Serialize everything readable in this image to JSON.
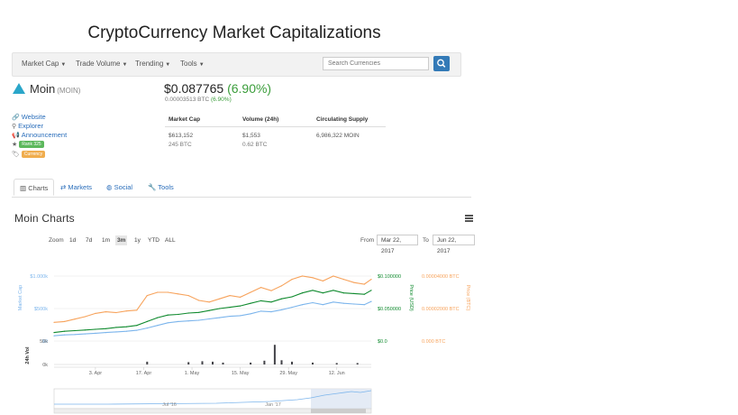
{
  "site": {
    "title": "CryptoCurrency Market Capitalizations"
  },
  "nav": {
    "items": [
      {
        "label": "Market Cap"
      },
      {
        "label": "Trade Volume"
      },
      {
        "label": "Trending"
      },
      {
        "label": "Tools"
      }
    ],
    "search_placeholder": "Search Currencies",
    "search_icon": "search-icon"
  },
  "coin": {
    "name": "Moin",
    "symbol": "(MOIN)",
    "price_usd": "$0.087765",
    "change_usd": "(6.90%)",
    "price_btc": "0.00003513 BTC",
    "change_btc": "(6.90%)",
    "links": [
      {
        "label": "Website",
        "icon": "link-icon"
      },
      {
        "label": "Explorer",
        "icon": "search-icon"
      },
      {
        "label": "Announcement",
        "icon": "bullhorn-icon"
      }
    ],
    "rank_badge": "Rank 325",
    "tag_badge": "Currency",
    "colors": {
      "rank_badge": "#5cb85c",
      "tag_badge": "#f0ad4e",
      "positive": "#3a9d3a",
      "link": "#2a6ebb"
    }
  },
  "stats": {
    "headers": [
      "Market Cap",
      "Volume (24h)",
      "Circulating Supply"
    ],
    "market_cap_usd": "$613,152",
    "market_cap_btc": "245 BTC",
    "volume_usd": "$1,553",
    "volume_btc": "0.62 BTC",
    "supply": "6,986,322 MOIN"
  },
  "tabs": [
    {
      "label": "Charts",
      "icon": "bar-chart-icon",
      "active": true
    },
    {
      "label": "Markets",
      "icon": "exchange-icon",
      "active": false
    },
    {
      "label": "Social",
      "icon": "globe-icon",
      "active": false
    },
    {
      "label": "Tools",
      "icon": "wrench-icon",
      "active": false
    }
  ],
  "chart_section": {
    "title": "Moin Charts",
    "zoom_label": "Zoom",
    "zoom_options": [
      "1d",
      "7d",
      "1m",
      "3m",
      "1y",
      "YTD",
      "ALL"
    ],
    "zoom_selected": "3m",
    "from_label": "From",
    "from_value": "Mar 22, 2017",
    "to_label": "To",
    "to_value": "Jun 22, 2017"
  },
  "chart_data": {
    "type": "line",
    "x_type": "date",
    "x_range": [
      "2017-03-22",
      "2017-06-22"
    ],
    "x_ticks": [
      "3. Apr",
      "17. Apr",
      "1. May",
      "15. May",
      "29. May",
      "12. Jun"
    ],
    "axes": {
      "market_cap": {
        "label": "Market Cap",
        "ticks": [
          "$0",
          "$500k",
          "$1.000k"
        ],
        "ylim": [
          0,
          1000000
        ]
      },
      "price_usd": {
        "label": "Price (USD)",
        "ticks": [
          "$0.0",
          "$0.050000",
          "$0.100000"
        ],
        "ylim": [
          0,
          0.1
        ]
      },
      "price_btc": {
        "label": "Price (BTC)",
        "ticks": [
          "0.000 BTC",
          "0.00002000 BTC",
          "0.00004000 BTC"
        ],
        "ylim": [
          0,
          4e-05
        ]
      },
      "volume": {
        "label": "24h Vol",
        "ticks": [
          "0k",
          "50k"
        ]
      }
    },
    "series": [
      {
        "name": "Market Cap",
        "color": "#7cb5ec",
        "axis": "market_cap",
        "x": [
          "2017-03-22",
          "2017-03-25",
          "2017-03-28",
          "2017-03-31",
          "2017-04-03",
          "2017-04-06",
          "2017-04-09",
          "2017-04-12",
          "2017-04-15",
          "2017-04-18",
          "2017-04-21",
          "2017-04-24",
          "2017-04-27",
          "2017-04-30",
          "2017-05-03",
          "2017-05-06",
          "2017-05-09",
          "2017-05-12",
          "2017-05-15",
          "2017-05-18",
          "2017-05-21",
          "2017-05-24",
          "2017-05-27",
          "2017-05-30",
          "2017-06-02",
          "2017-06-05",
          "2017-06-08",
          "2017-06-11",
          "2017-06-14",
          "2017-06-17",
          "2017-06-20",
          "2017-06-22"
        ],
        "values": [
          80000,
          95000,
          100000,
          110000,
          120000,
          130000,
          140000,
          150000,
          165000,
          200000,
          240000,
          280000,
          300000,
          310000,
          320000,
          340000,
          360000,
          380000,
          390000,
          420000,
          460000,
          450000,
          480000,
          520000,
          560000,
          590000,
          560000,
          600000,
          580000,
          570000,
          560000,
          610000
        ]
      },
      {
        "name": "Price (USD)",
        "color": "#0f8a2e",
        "axis": "price_usd",
        "x": [
          "2017-03-22",
          "2017-03-25",
          "2017-03-28",
          "2017-03-31",
          "2017-04-03",
          "2017-04-06",
          "2017-04-09",
          "2017-04-12",
          "2017-04-15",
          "2017-04-18",
          "2017-04-21",
          "2017-04-24",
          "2017-04-27",
          "2017-04-30",
          "2017-05-03",
          "2017-05-06",
          "2017-05-09",
          "2017-05-12",
          "2017-05-15",
          "2017-05-18",
          "2017-05-21",
          "2017-05-24",
          "2017-05-27",
          "2017-05-30",
          "2017-06-02",
          "2017-06-05",
          "2017-06-08",
          "2017-06-11",
          "2017-06-14",
          "2017-06-17",
          "2017-06-20",
          "2017-06-22"
        ],
        "values": [
          0.013,
          0.015,
          0.016,
          0.017,
          0.018,
          0.019,
          0.021,
          0.022,
          0.024,
          0.03,
          0.036,
          0.04,
          0.041,
          0.043,
          0.044,
          0.047,
          0.05,
          0.052,
          0.054,
          0.058,
          0.062,
          0.06,
          0.065,
          0.068,
          0.074,
          0.078,
          0.074,
          0.078,
          0.074,
          0.073,
          0.072,
          0.078
        ]
      },
      {
        "name": "Price (BTC)",
        "color": "#f7a35c",
        "axis": "price_btc",
        "x": [
          "2017-03-22",
          "2017-03-25",
          "2017-03-28",
          "2017-03-31",
          "2017-04-03",
          "2017-04-06",
          "2017-04-09",
          "2017-04-12",
          "2017-04-15",
          "2017-04-18",
          "2017-04-21",
          "2017-04-24",
          "2017-04-27",
          "2017-04-30",
          "2017-05-03",
          "2017-05-06",
          "2017-05-09",
          "2017-05-12",
          "2017-05-15",
          "2017-05-18",
          "2017-05-21",
          "2017-05-24",
          "2017-05-27",
          "2017-05-30",
          "2017-06-02",
          "2017-06-05",
          "2017-06-08",
          "2017-06-11",
          "2017-06-14",
          "2017-06-17",
          "2017-06-20",
          "2017-06-22"
        ],
        "values": [
          1.15e-05,
          1.2e-05,
          1.35e-05,
          1.5e-05,
          1.7e-05,
          1.8e-05,
          1.75e-05,
          1.85e-05,
          1.9e-05,
          2.8e-05,
          3e-05,
          3e-05,
          2.9e-05,
          2.8e-05,
          2.5e-05,
          2.4e-05,
          2.6e-05,
          2.8e-05,
          2.7e-05,
          3e-05,
          3.3e-05,
          3.1e-05,
          3.4e-05,
          3.8e-05,
          4e-05,
          3.9e-05,
          3.7e-05,
          4e-05,
          3.8e-05,
          3.6e-05,
          3.5e-05,
          3.8e-05
        ]
      },
      {
        "name": "24h Vol",
        "color": "#434348",
        "axis": "volume",
        "x": [
          "2017-04-18",
          "2017-04-30",
          "2017-05-04",
          "2017-05-07",
          "2017-05-10",
          "2017-05-18",
          "2017-05-22",
          "2017-05-25",
          "2017-05-27",
          "2017-05-30",
          "2017-06-05",
          "2017-06-12",
          "2017-06-18"
        ],
        "values": [
          6000,
          5000,
          7000,
          6000,
          4000,
          4000,
          8000,
          42000,
          9000,
          6000,
          4000,
          3000,
          3000
        ]
      }
    ],
    "navigator": {
      "tick_labels": [
        "Jul '16",
        "Jan '17"
      ]
    }
  }
}
